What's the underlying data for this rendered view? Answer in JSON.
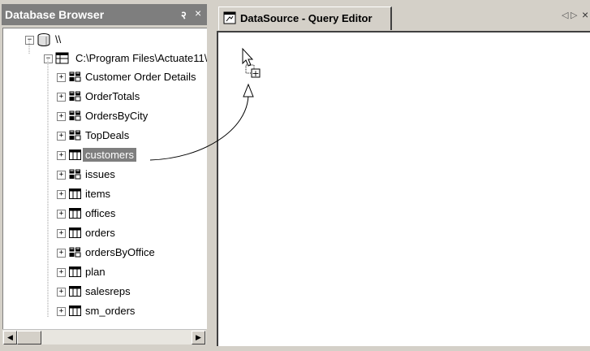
{
  "database_browser": {
    "title": "Database Browser",
    "pin_glyph": "२",
    "close_glyph": "×",
    "tree": {
      "root": {
        "label": "\\\\",
        "expander": "−"
      },
      "source": {
        "label": "C:\\Program Files\\Actuate11\\",
        "expander": "−"
      },
      "items": [
        {
          "label": "Customer Order Details",
          "type": "view",
          "expander": "+"
        },
        {
          "label": "OrderTotals",
          "type": "view",
          "expander": "+"
        },
        {
          "label": "OrdersByCity",
          "type": "view",
          "expander": "+"
        },
        {
          "label": "TopDeals",
          "type": "view",
          "expander": "+"
        },
        {
          "label": "customers",
          "type": "table",
          "expander": "+",
          "selected": true
        },
        {
          "label": "issues",
          "type": "view",
          "expander": "+"
        },
        {
          "label": "items",
          "type": "table",
          "expander": "+"
        },
        {
          "label": "offices",
          "type": "table",
          "expander": "+"
        },
        {
          "label": "orders",
          "type": "table",
          "expander": "+"
        },
        {
          "label": "ordersByOffice",
          "type": "view",
          "expander": "+"
        },
        {
          "label": "plan",
          "type": "table",
          "expander": "+"
        },
        {
          "label": "salesreps",
          "type": "table",
          "expander": "+"
        },
        {
          "label": "sm_orders",
          "type": "table",
          "expander": "+"
        }
      ]
    },
    "scrollbar": {
      "left_arrow": "◀",
      "right_arrow": "▶"
    }
  },
  "query_editor": {
    "tab_label": "DataSource - Query Editor",
    "nav_left": "◁",
    "nav_right": "▷",
    "close_glyph": "×"
  },
  "drag_indicator": {
    "cursor": "arrow-copy-cursor",
    "plus_glyph": "+"
  },
  "colors": {
    "panel_bg": "#d4d0c8",
    "title_bar": "#7e7e7e",
    "selection": "#7e7e7e",
    "editor_bg": "#ffffff"
  }
}
